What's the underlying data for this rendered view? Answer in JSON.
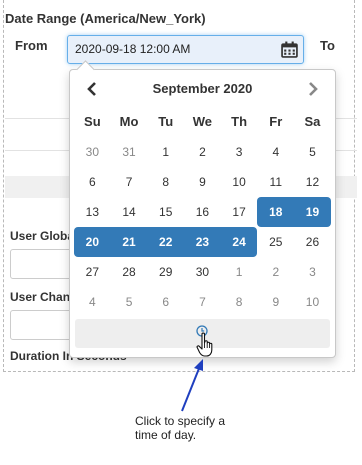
{
  "form": {
    "section_title": "Date Range (America/New_York)",
    "from_label": "From",
    "to_label": "To",
    "from_value": "2020-09-18 12:00 AM",
    "field_user_global": "User Globa",
    "field_user_change": "User Chan",
    "field_duration": "Duration In Seconds"
  },
  "datepicker": {
    "month_label": "September 2020",
    "prev_icon": "chevron-left-icon",
    "next_icon": "chevron-right-icon",
    "weekdays": [
      "Su",
      "Mo",
      "Tu",
      "We",
      "Th",
      "Fr",
      "Sa"
    ],
    "weeks": [
      [
        "30",
        "31",
        "1",
        "2",
        "3",
        "4",
        "5"
      ],
      [
        "6",
        "7",
        "8",
        "9",
        "10",
        "11",
        "12"
      ],
      [
        "13",
        "14",
        "15",
        "16",
        "17",
        "18",
        "19"
      ],
      [
        "20",
        "21",
        "22",
        "23",
        "24",
        "25",
        "26"
      ],
      [
        "27",
        "28",
        "29",
        "30",
        "1",
        "2",
        "3"
      ],
      [
        "4",
        "5",
        "6",
        "7",
        "8",
        "9",
        "10"
      ]
    ],
    "selected_range": "2020-09-18 to 2020-09-24",
    "accent_color": "#337ab7",
    "time_icon": "clock-icon"
  },
  "callout": {
    "text_line1": "Click to specify a",
    "text_line2": "time of day."
  }
}
